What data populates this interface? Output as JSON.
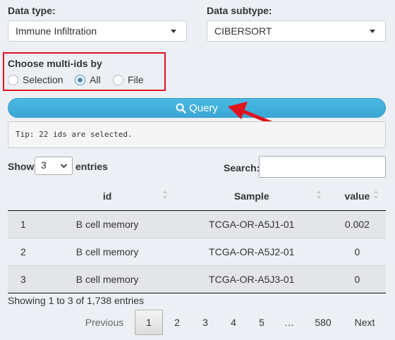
{
  "filters": {
    "data_type_label": "Data type:",
    "data_type_value": "Immune Infiltration",
    "data_subtype_label": "Data subtype:",
    "data_subtype_value": "CIBERSORT"
  },
  "multi_ids": {
    "label": "Choose multi-ids by",
    "options": [
      "Selection",
      "All",
      "File"
    ],
    "selected": "All"
  },
  "query_button": {
    "label": "Query"
  },
  "tip": "Tip: 22 ids are selected.",
  "length_menu": {
    "show_label": "Show",
    "value": "3",
    "entries_label": "entries"
  },
  "search": {
    "label": "Search:",
    "value": ""
  },
  "table": {
    "columns": [
      "",
      "id",
      "Sample",
      "value"
    ],
    "rows": [
      [
        "1",
        "B cell memory",
        "TCGA-OR-A5J1-01",
        "0.002"
      ],
      [
        "2",
        "B cell memory",
        "TCGA-OR-A5J2-01",
        "0"
      ],
      [
        "3",
        "B cell memory",
        "TCGA-OR-A5J3-01",
        "0"
      ]
    ]
  },
  "info": "Showing 1 to 3 of 1,738 entries",
  "pagination": {
    "previous": "Previous",
    "pages": [
      "1",
      "2",
      "3",
      "4",
      "5",
      "…",
      "580"
    ],
    "current": "1",
    "next": "Next"
  },
  "colors": {
    "background": "#ecf0f5",
    "accent": "#3c8dbc",
    "button": "#4ab9e2",
    "highlight_box": "#e0141e",
    "arrow": "#e0141e"
  }
}
